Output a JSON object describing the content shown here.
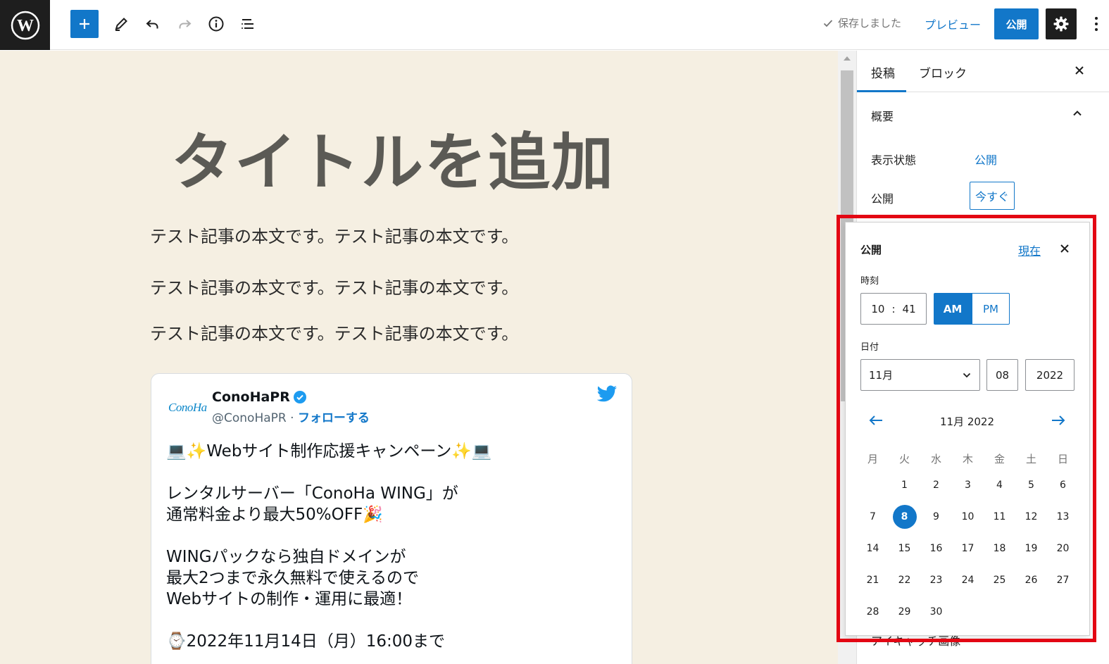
{
  "topbar": {
    "saved_text": "保存しました",
    "preview_label": "プレビュー",
    "publish_label": "公開"
  },
  "editor": {
    "title_placeholder": "タイトルを追加",
    "paragraphs": [
      "テスト記事の本文です。テスト記事の本文です。",
      "テスト記事の本文です。テスト記事の本文です。",
      "テスト記事の本文です。テスト記事の本文です。"
    ],
    "tweet": {
      "logo_text": "ConoHa",
      "author_name": "ConoHaPR",
      "handle": "@ConoHaPR",
      "separator": " · ",
      "follow_label": "フォローする",
      "lines": [
        "💻✨Webサイト制作応援キャンペーン✨💻",
        "レンタルサーバー「ConoHa WING」が",
        "通常料金より最大50%OFF🎉",
        "WINGパックなら独自ドメインが",
        "最大2つまで永久無料で使えるので",
        "Webサイトの制作・運用に最適！",
        "⌚2022年11月14日（月）16:00まで"
      ]
    }
  },
  "sidebar": {
    "tabs": [
      "投稿",
      "ブロック"
    ],
    "section_title": "概要",
    "visibility_label": "表示状態",
    "visibility_value": "公開",
    "publish_label": "公開",
    "publish_value": "今すぐ",
    "featured_image_label": "アイキャッチ画像"
  },
  "popover": {
    "title": "公開",
    "now_link": "現在",
    "time_label": "時刻",
    "hour": "10",
    "time_sep": ":",
    "minute": "41",
    "am_label": "AM",
    "pm_label": "PM",
    "date_label": "日付",
    "month_value": "11月",
    "day_value": "08",
    "year_value": "2022",
    "calendar_caption": "11月 2022",
    "weekdays": [
      "月",
      "火",
      "水",
      "木",
      "金",
      "土",
      "日"
    ],
    "weeks": [
      [
        "",
        "1",
        "2",
        "3",
        "4",
        "5",
        "6"
      ],
      [
        "7",
        "8",
        "9",
        "10",
        "11",
        "12",
        "13"
      ],
      [
        "14",
        "15",
        "16",
        "17",
        "18",
        "19",
        "20"
      ],
      [
        "21",
        "22",
        "23",
        "24",
        "25",
        "26",
        "27"
      ],
      [
        "28",
        "29",
        "30",
        "",
        "",
        "",
        ""
      ]
    ],
    "selected_day": "8"
  },
  "colors": {
    "accent": "#1277c9",
    "editor_bg": "#f5efe2",
    "highlight_border": "#e30613"
  }
}
